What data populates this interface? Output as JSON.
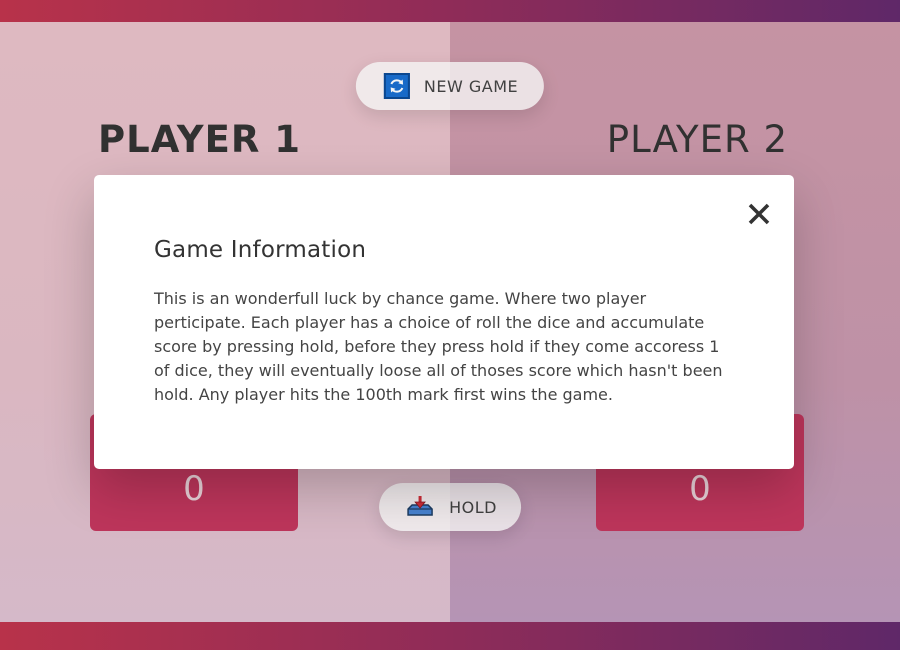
{
  "players": [
    {
      "name": "PLAYER 1",
      "current_score": "0"
    },
    {
      "name": "PLAYER 2",
      "current_score": "0"
    }
  ],
  "buttons": {
    "new_game": {
      "label": "NEW GAME",
      "icon": "refresh-icon"
    },
    "hold": {
      "label": "HOLD",
      "icon": "hold-icon"
    }
  },
  "modal": {
    "title": "Game Information",
    "text": "This is an wonderfull luck by chance game. Where two player perticipate. Each player has a choice of roll the dice and accumulate score by pressing hold, before they press hold if they come accoress 1 of dice, they will eventually loose all of thoses score which hasn't been hold. Any player hits the 100th mark first wins the game.",
    "close_icon": "close-icon"
  },
  "colors": {
    "accent": "#c5385f",
    "player1_bg": "#e8c1c9",
    "player2_bg": "#ce9aaa"
  }
}
